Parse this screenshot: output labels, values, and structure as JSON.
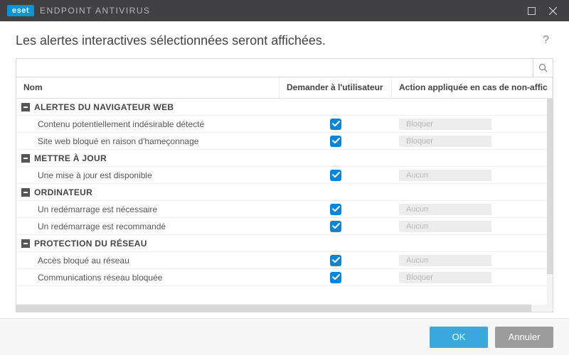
{
  "titlebar": {
    "logo": "eset",
    "product": "ENDPOINT ANTIVIRUS"
  },
  "header": {
    "title": "Les alertes interactives sélectionnées seront affichées.",
    "help": "?"
  },
  "search": {
    "value": "",
    "placeholder": ""
  },
  "columns": {
    "name": "Nom",
    "ask": "Demander à l'utilisateur",
    "action": "Action appliquée en cas de non-affic"
  },
  "groups": [
    {
      "label": "ALERTES DU NAVIGATEUR WEB",
      "items": [
        {
          "label": "Contenu potentiellement indésirable détecté",
          "ask": true,
          "action": "Bloquer"
        },
        {
          "label": "Site web bloqué en raison d'hameçonnage",
          "ask": true,
          "action": "Bloquer"
        }
      ]
    },
    {
      "label": "METTRE À JOUR",
      "items": [
        {
          "label": "Une mise à jour est disponible",
          "ask": true,
          "action": "Aucun"
        }
      ]
    },
    {
      "label": "ORDINATEUR",
      "items": [
        {
          "label": "Un redémarrage est nécessaire",
          "ask": true,
          "action": "Aucun"
        },
        {
          "label": "Un redémarrage est recommandé",
          "ask": true,
          "action": "Aucun"
        }
      ]
    },
    {
      "label": "PROTECTION DU RÉSEAU",
      "items": [
        {
          "label": "Accès bloqué au réseau",
          "ask": true,
          "action": "Aucun"
        },
        {
          "label": "Communications réseau bloquée",
          "ask": true,
          "action": "Bloquer"
        }
      ]
    }
  ],
  "footer": {
    "ok": "OK",
    "cancel": "Annuler"
  }
}
